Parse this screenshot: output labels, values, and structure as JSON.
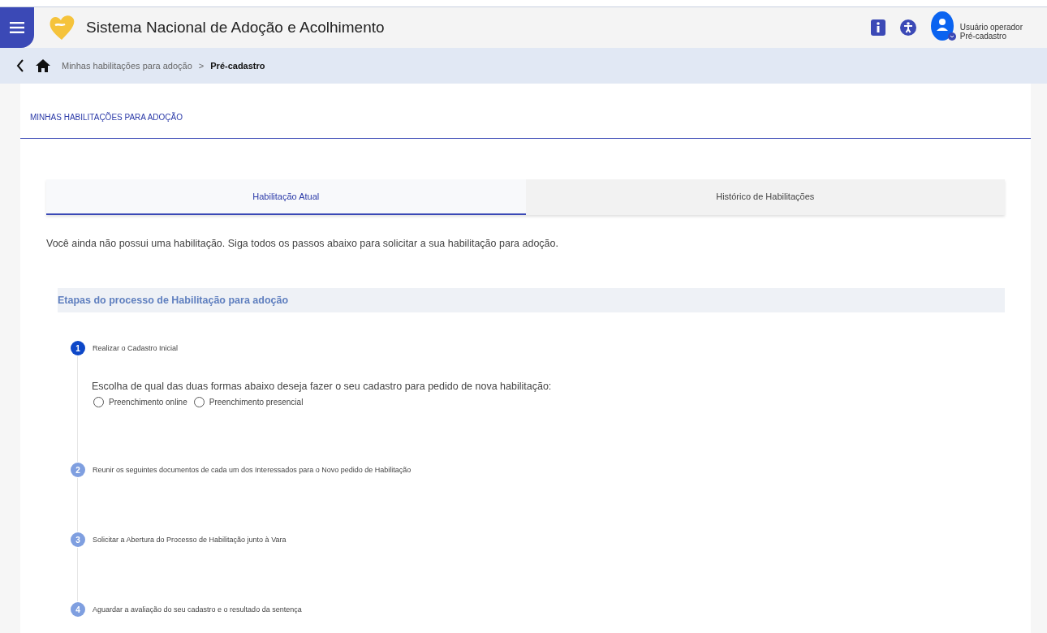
{
  "header": {
    "title": "Sistema Nacional de Adoção e Acolhimento",
    "user": {
      "name": "Usuário operador",
      "role": "Pré-cadastro"
    }
  },
  "breadcrumb": [
    {
      "label": "Minhas habilitações para adoção",
      "current": false
    },
    {
      "label": "Pré-cadastro",
      "current": true
    }
  ],
  "breadcrumb_separator": ">",
  "page_title": "MINHAS HABILITAÇÕES PARA ADOÇÃO",
  "tabs": [
    {
      "label": "Habilitação Atual",
      "selected": true
    },
    {
      "label": "Histórico de Habilitações",
      "selected": false
    }
  ],
  "intro": "Você ainda não possui uma habilitação. Siga todos os passos abaixo para solicitar a sua habilitação para adoção.",
  "section_title": "Etapas do processo de Habilitação para adoção",
  "steps": [
    {
      "number": "1",
      "label": "Realizar o Cadastro Inicial",
      "active": true,
      "prompt": "Escolha de qual das duas formas abaixo deseja fazer o seu cadastro para pedido de nova habilitação:",
      "options": [
        {
          "label": "Preenchimento online",
          "selected": false
        },
        {
          "label": "Preenchimento presencial",
          "selected": false
        }
      ]
    },
    {
      "number": "2",
      "label": "Reunir os seguintes documentos de cada um dos Interessados para o Novo pedido de Habilitação",
      "active": false
    },
    {
      "number": "3",
      "label": "Solicitar a Abertura do Processo de Habilitação junto à Vara",
      "active": false
    },
    {
      "number": "4",
      "label": "Aguardar a avaliação do seu cadastro e o resultado da sentença",
      "active": false
    }
  ]
}
